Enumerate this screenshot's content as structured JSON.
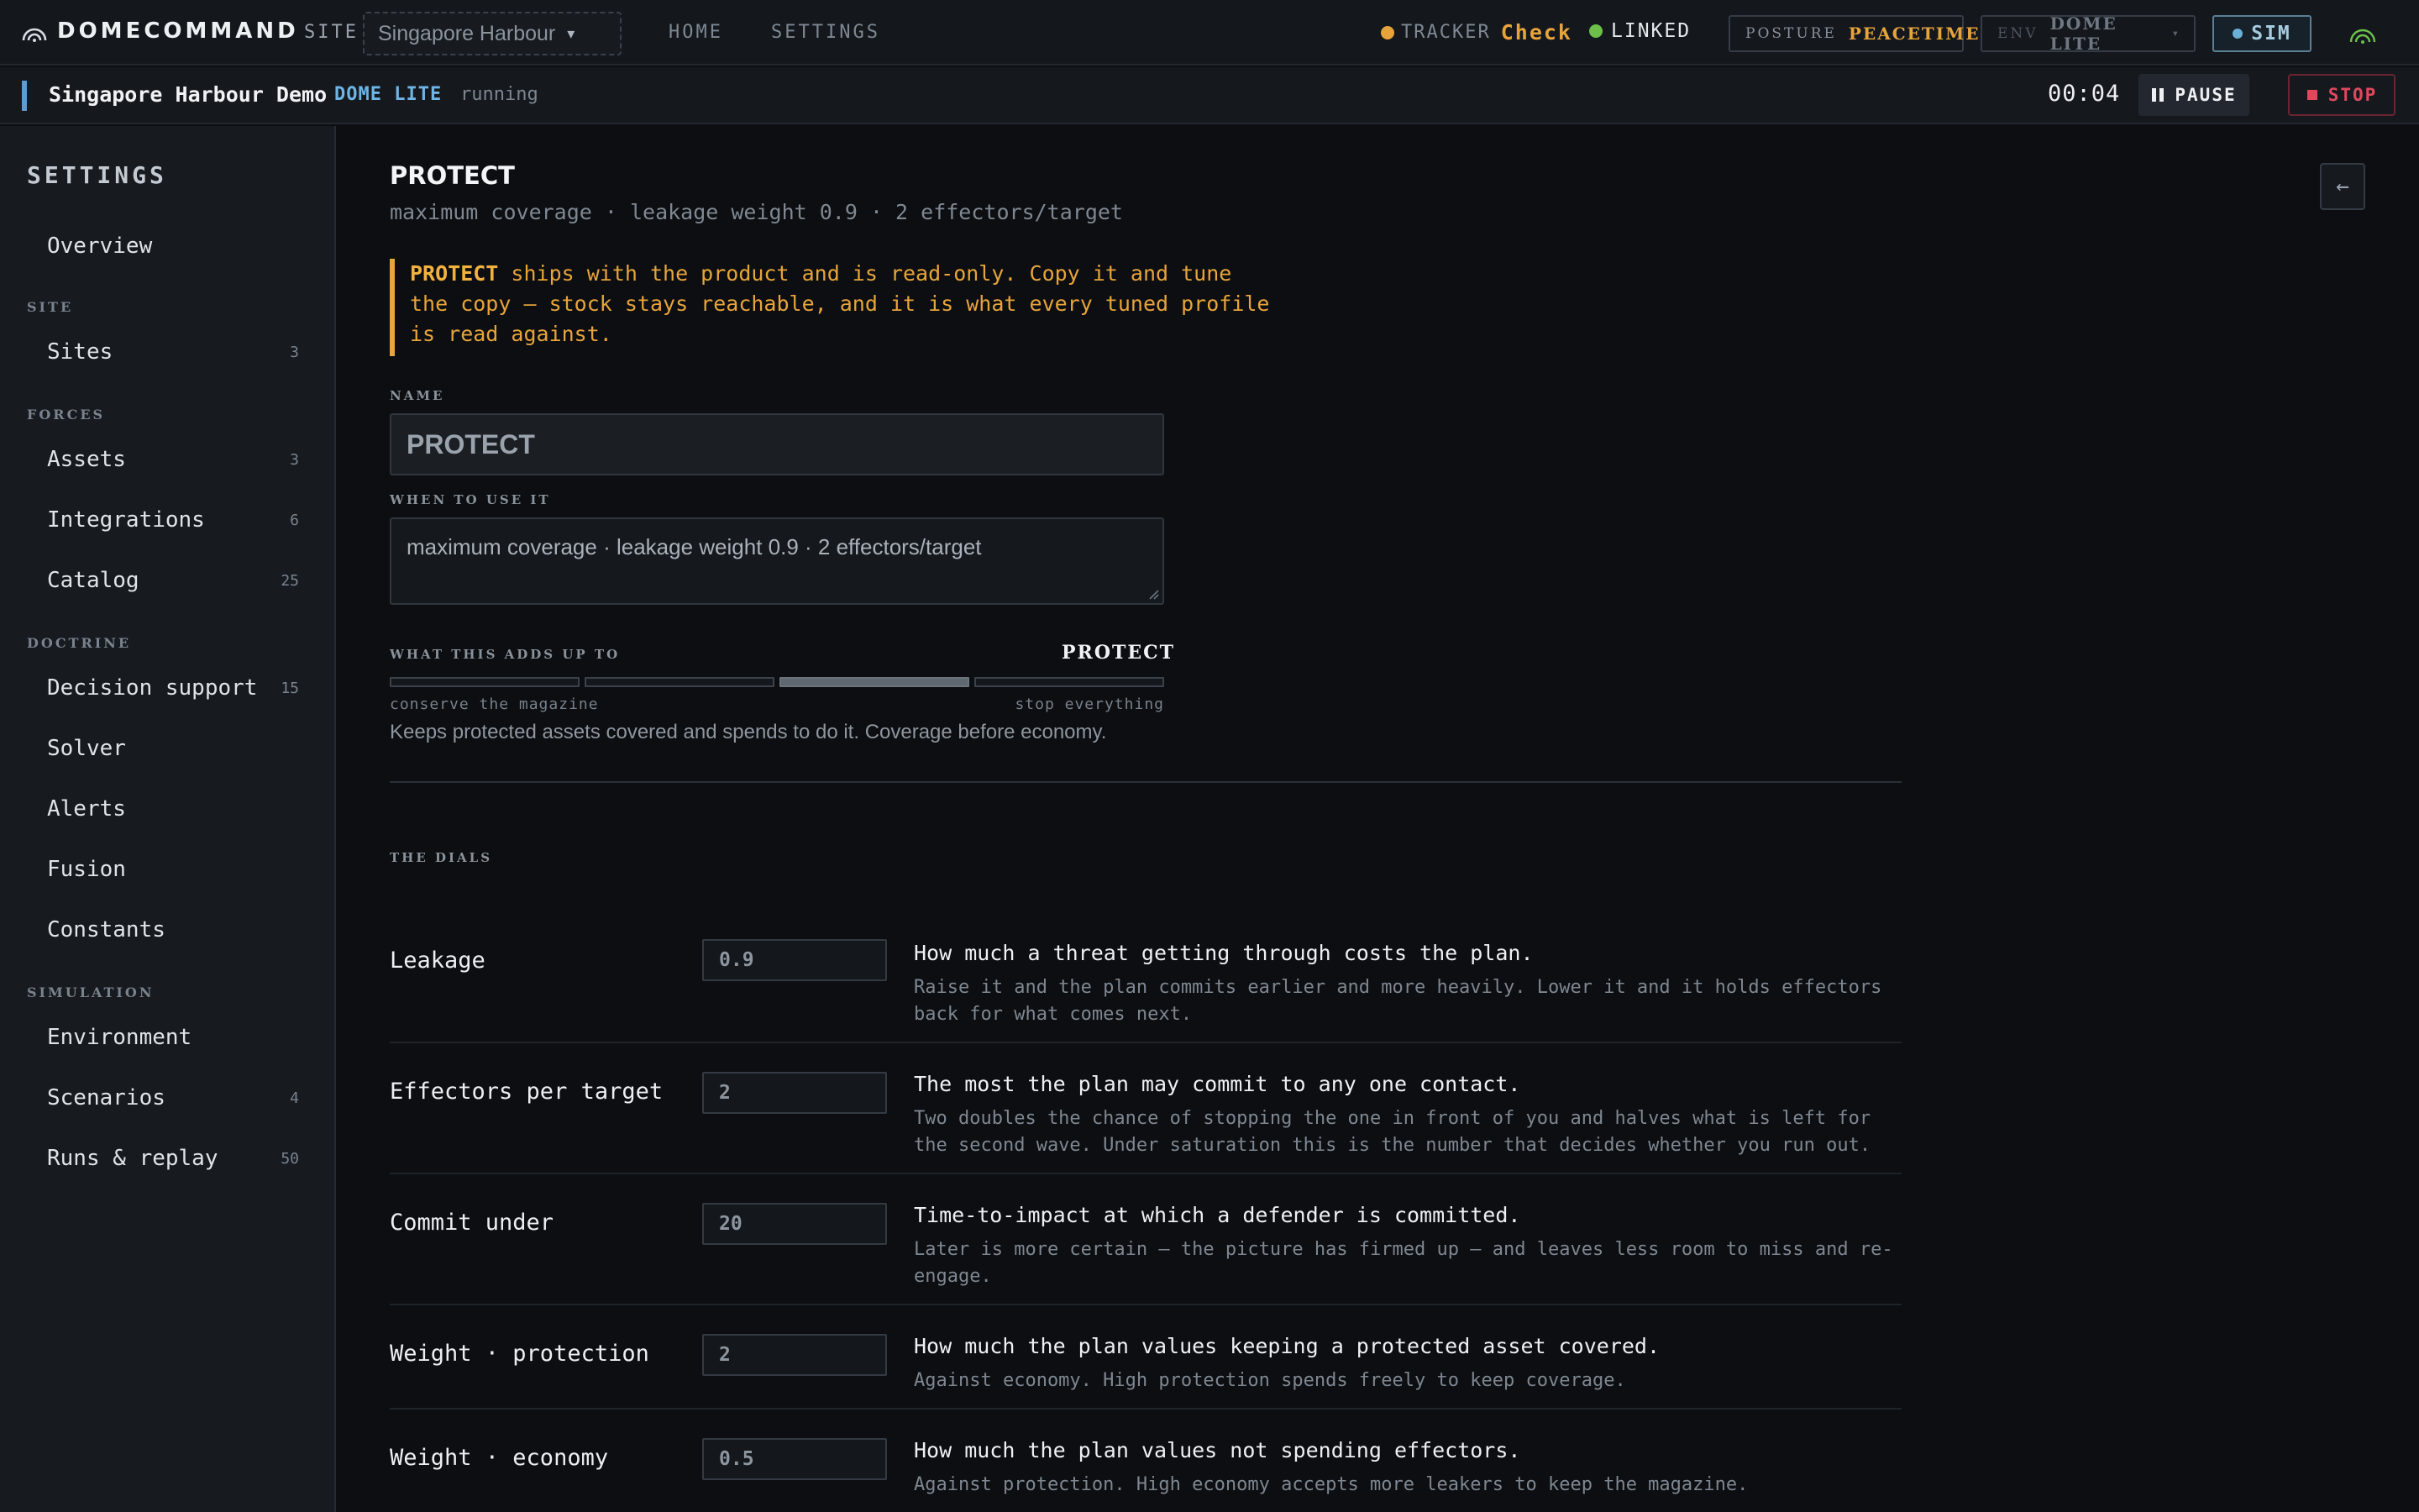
{
  "app": {
    "brand": "DOMECOMMAND"
  },
  "topbar": {
    "site_label": "SITE",
    "site_value": "Singapore Harbour",
    "nav": [
      "HOME",
      "SETTINGS"
    ],
    "tracker_label": "TRACKER",
    "tracker_value": "Check",
    "linked": "LINKED",
    "posture_label": "POSTURE",
    "posture_value": "PEACETIME",
    "env_label": "ENV",
    "env_value": "DOME LITE",
    "sim": "SIM",
    "colors": {
      "tracker_dot": "#e7a43a",
      "linked_dot": "#6cc04a",
      "accent": "#e7a43a",
      "sim": "#6ab0d8"
    }
  },
  "session": {
    "title": "Singapore Harbour Demo",
    "env": "DOME LITE",
    "state": "running",
    "timer": "00:04",
    "pause": "PAUSE",
    "stop": "STOP"
  },
  "sidebar": {
    "title": "SETTINGS",
    "overview": "Overview",
    "groups": {
      "site": "SITE",
      "forces": "FORCES",
      "doctrine": "DOCTRINE",
      "simulation": "SIMULATION"
    },
    "items": [
      {
        "label": "Sites",
        "count": "3"
      },
      {
        "label": "Assets",
        "count": "3"
      },
      {
        "label": "Integrations",
        "count": "6"
      },
      {
        "label": "Catalog",
        "count": "25"
      },
      {
        "label": "Decision support",
        "count": "15"
      },
      {
        "label": "Solver",
        "count": ""
      },
      {
        "label": "Alerts",
        "count": ""
      },
      {
        "label": "Fusion",
        "count": ""
      },
      {
        "label": "Constants",
        "count": ""
      },
      {
        "label": "Environment",
        "count": ""
      },
      {
        "label": "Scenarios",
        "count": "4"
      },
      {
        "label": "Runs & replay",
        "count": "50"
      }
    ]
  },
  "profile": {
    "title": "PROTECT",
    "subtitle": "maximum coverage · leakage weight 0.9 · 2 effectors/target",
    "notice_strong": "PROTECT",
    "notice_rest": " ships with the product and is read-only. Copy it and tune the copy — stock stays reachable, and it is what every tuned profile is read against.",
    "name_label": "NAME",
    "name_value": "PROTECT",
    "when_label": "WHEN TO USE IT",
    "when_value": "maximum coverage · leakage weight 0.9 · 2 effectors/target",
    "adds_label": "WHAT THIS ADDS UP TO",
    "adds_value": "PROTECT",
    "scale_level": "3 of 4",
    "scale_left": "conserve the magazine",
    "scale_right": "stop everything",
    "description": "Keeps protected assets covered and spends to do it. Coverage before economy.",
    "dials_label": "THE DIALS"
  },
  "dials": [
    {
      "name": "Leakage",
      "value": "0.9",
      "head": "How much a threat getting through costs the plan.",
      "body": "Raise it and the plan commits earlier and more heavily. Lower it and it holds effectors back for what comes next."
    },
    {
      "name": "Effectors per target",
      "value": "2",
      "head": "The most the plan may commit to any one contact.",
      "body": "Two doubles the chance of stopping the one in front of you and halves what is left for the second wave. Under saturation this is the number that decides whether you run out."
    },
    {
      "name": "Commit under",
      "value": "20",
      "head": "Time-to-impact at which a defender is committed.",
      "body": "Later is more certain — the picture has firmed up — and leaves less room to miss and re-engage."
    },
    {
      "name": "Weight · protection",
      "value": "2",
      "head": "How much the plan values keeping a protected asset covered.",
      "body": "Against economy. High protection spends freely to keep coverage."
    },
    {
      "name": "Weight · economy",
      "value": "0.5",
      "head": "How much the plan values not spending effectors.",
      "body": "Against protection. High economy accepts more leakers to keep the magazine."
    }
  ]
}
